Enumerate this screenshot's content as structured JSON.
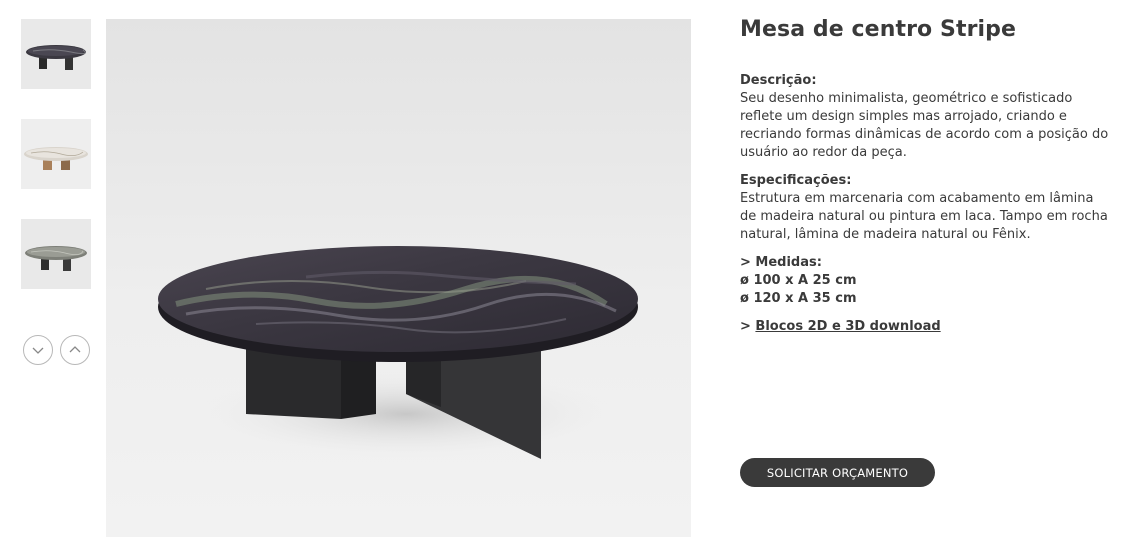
{
  "gallery": {
    "thumbnails": [
      {
        "alt": "Mesa preta com tampo de mármore escuro"
      },
      {
        "alt": "Mesa com tampo de mármore claro e base de madeira"
      },
      {
        "alt": "Mesa com tampo de rocha cinza"
      }
    ],
    "arrows": {
      "down_icon": "chevron-down-icon",
      "up_icon": "chevron-up-icon"
    }
  },
  "product": {
    "title": "Mesa de centro Stripe",
    "description_label": "Descrição:",
    "description_text": "Seu desenho minimalista, geométrico e sofisticado reflete um design simples mas arrojado, criando e recriando formas dinâmicas de acordo com a posição do usuário ao redor da peça.",
    "specs_label": "Especificações:",
    "specs_text": "Estrutura em marcenaria com acabamento em lâmina de madeira natural ou pintura em laca. Tampo em rocha natural, lâmina de madeira natural ou Fênix.",
    "measures_label": "> Medidas:",
    "measures": [
      "ø 100 x A 25 cm",
      "ø 120 x A 35 cm"
    ],
    "download_prefix": "> ",
    "download_link": "Blocos 2D e 3D download",
    "cta_label": "SOLICITAR ORÇAMENTO"
  },
  "colors": {
    "text": "#3a3a3a",
    "button_bg": "#3a3a3a",
    "button_text": "#ffffff"
  }
}
